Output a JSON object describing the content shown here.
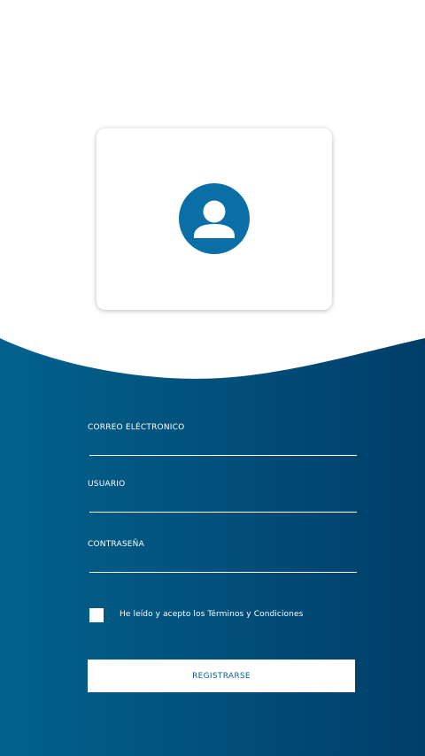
{
  "colors": {
    "gradient_left": "#02628d",
    "gradient_right": "#003e69",
    "avatar_blue": "#0a6fa6",
    "button_text": "#0a5f8f"
  },
  "avatar": {
    "icon": "user-icon"
  },
  "form": {
    "email_label": "CORREO ELÉCTRONICO",
    "email_value": "",
    "username_label": "USUARIO",
    "username_value": "",
    "password_label": "CONTRASEÑA",
    "password_value": "",
    "terms_text": "He leído y acepto los Términos y Condiciones",
    "terms_checked": false,
    "submit_label": "REGISTRARSE"
  }
}
